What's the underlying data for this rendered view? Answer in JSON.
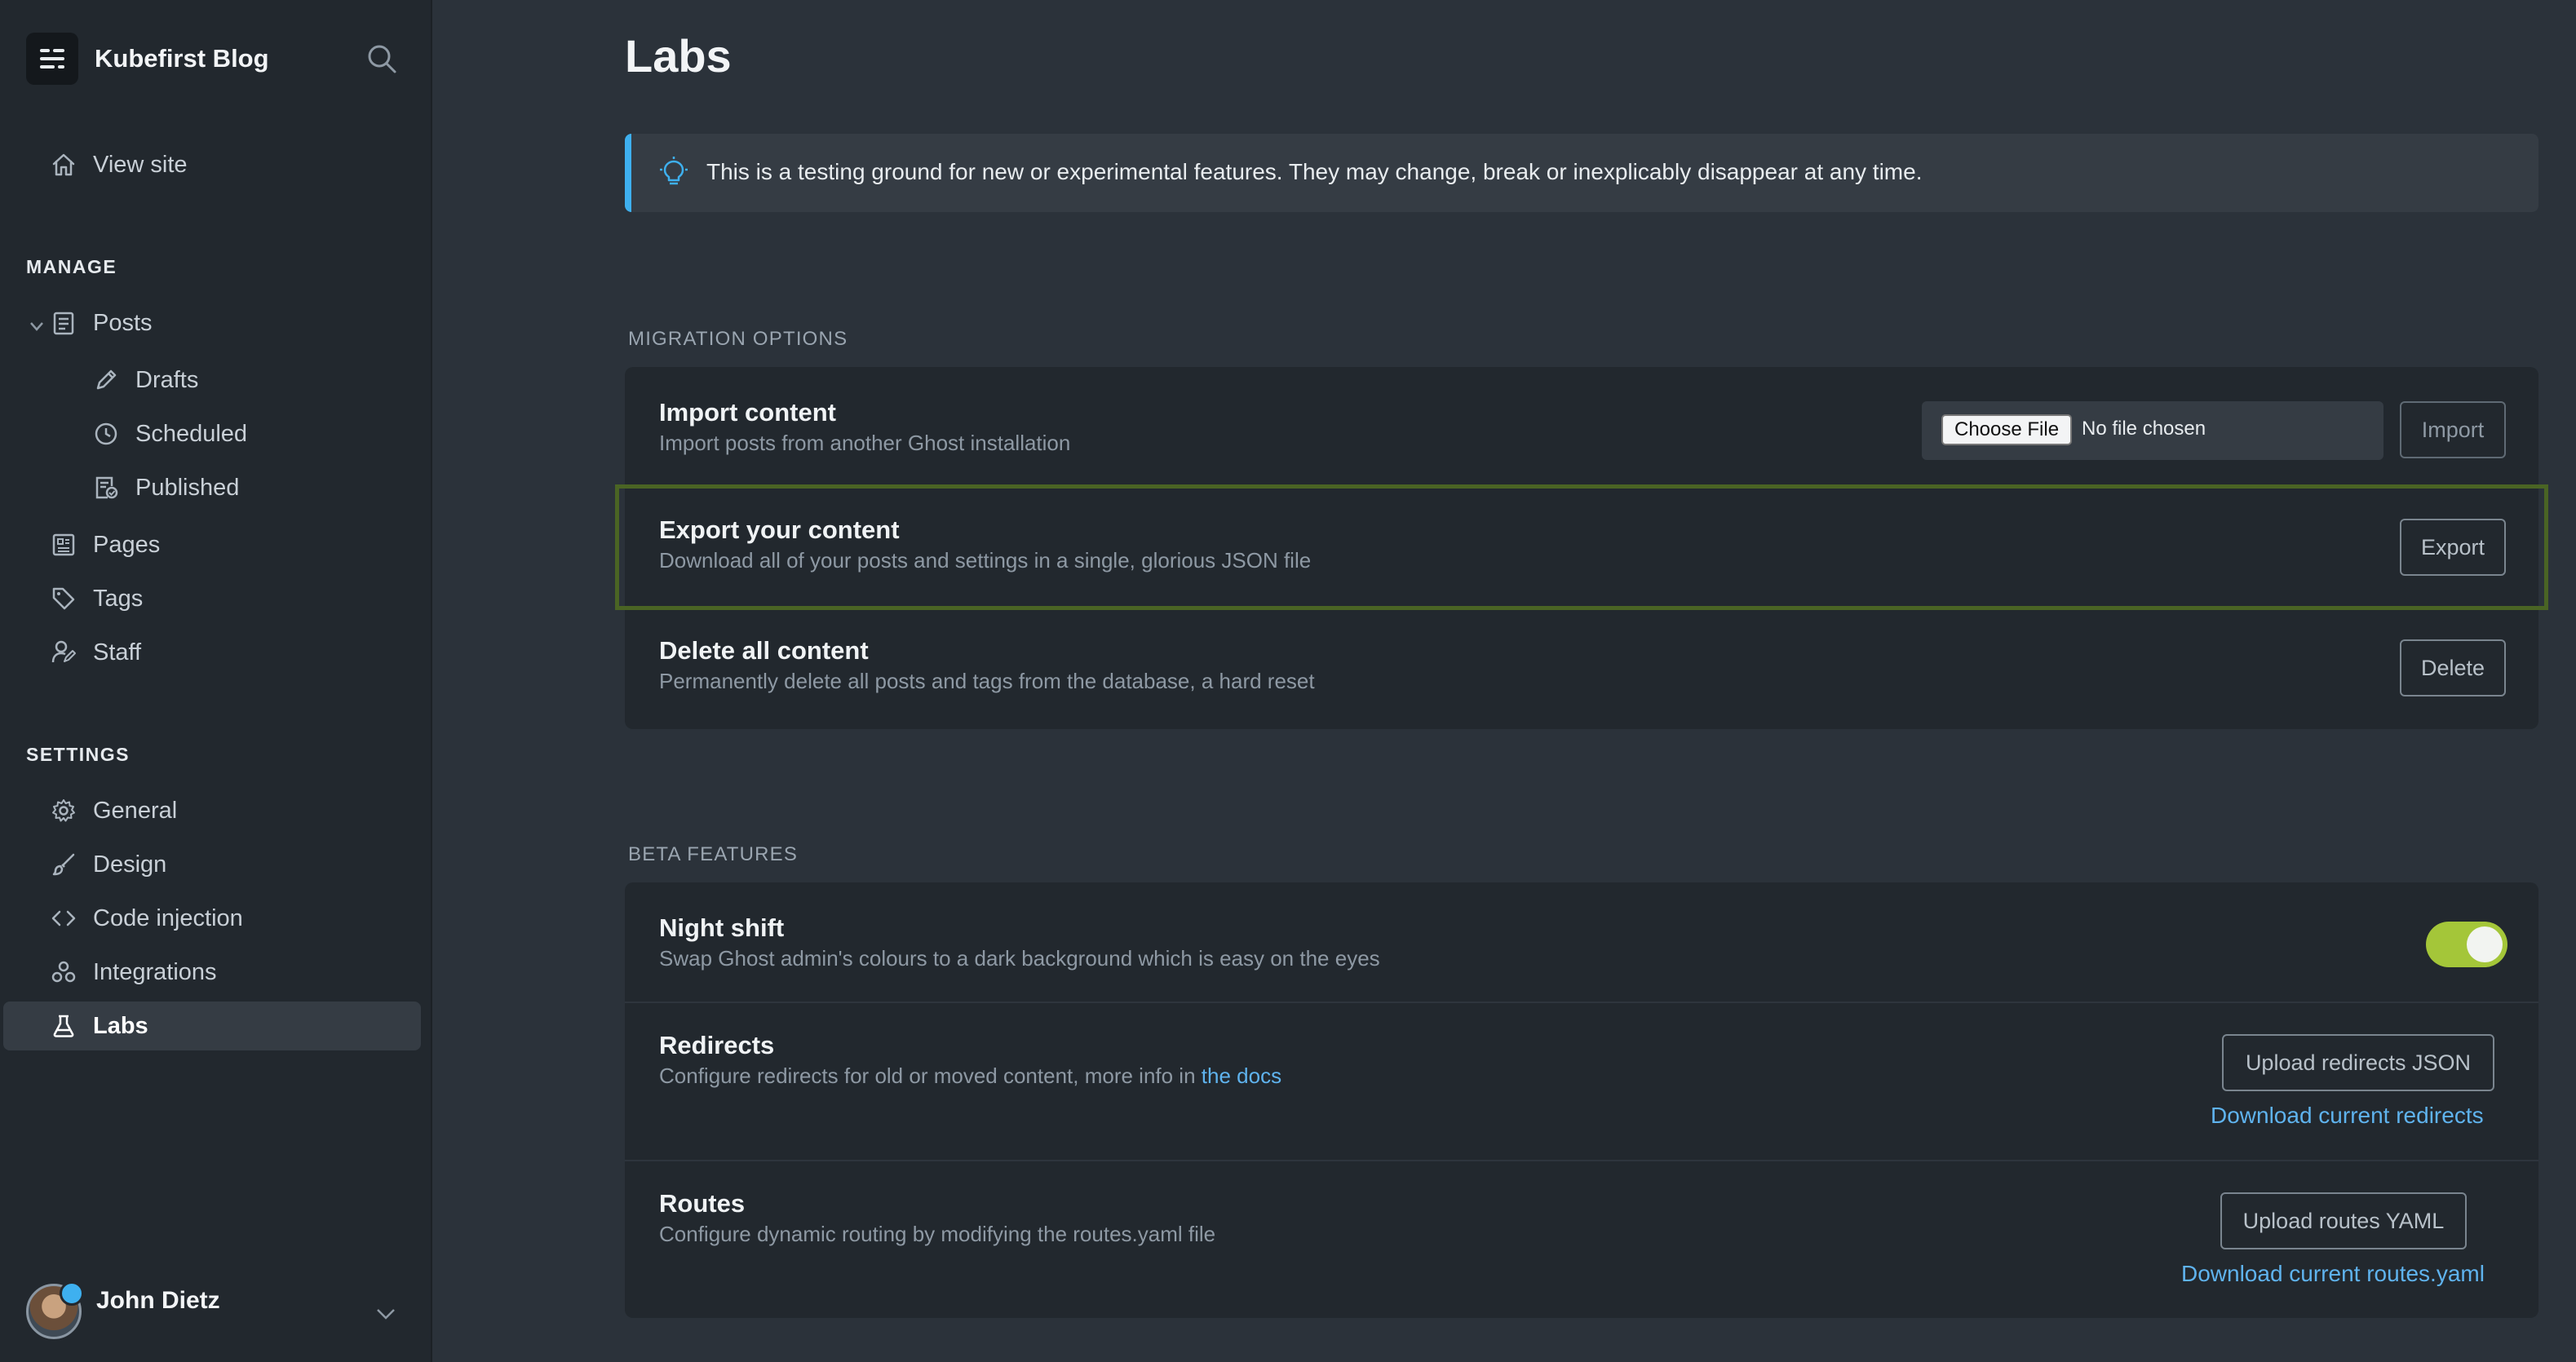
{
  "sidebar": {
    "brand": "Kubefirst Blog",
    "view_site": "View site",
    "manage_title": "MANAGE",
    "manage_items": {
      "posts": "Posts",
      "drafts": "Drafts",
      "scheduled": "Scheduled",
      "published": "Published",
      "pages": "Pages",
      "tags": "Tags",
      "staff": "Staff"
    },
    "settings_title": "SETTINGS",
    "settings_items": {
      "general": "General",
      "design": "Design",
      "code_injection": "Code injection",
      "integrations": "Integrations",
      "labs": "Labs"
    },
    "user_name": "John Dietz"
  },
  "main": {
    "title": "Labs",
    "alert": "This is a testing ground for new or experimental features. They may change, break or inexplicably disappear at any time.",
    "migration": {
      "title": "MIGRATION OPTIONS",
      "import": {
        "title": "Import content",
        "desc": "Import posts from another Ghost installation",
        "choose_file": "Choose File",
        "file_status": "No file chosen",
        "button": "Import"
      },
      "export": {
        "title": "Export your content",
        "desc": "Download all of your posts and settings in a single, glorious JSON file",
        "button": "Export"
      },
      "delete": {
        "title": "Delete all content",
        "desc": "Permanently delete all posts and tags from the database, a hard reset",
        "button": "Delete"
      }
    },
    "beta": {
      "title": "BETA FEATURES",
      "night_shift": {
        "title": "Night shift",
        "desc": "Swap Ghost admin's colours to a dark background which is easy on the eyes",
        "enabled": true
      },
      "redirects": {
        "title": "Redirects",
        "desc": "Configure redirects for old or moved content, more info in",
        "docs_link": "the docs",
        "upload_button": "Upload redirects JSON",
        "download_link": "Download current redirects"
      },
      "routes": {
        "title": "Routes",
        "desc": "Configure dynamic routing by modifying the routes.yaml file",
        "upload_button": "Upload routes YAML",
        "download_link": "Download current routes.yaml"
      }
    }
  },
  "colors": {
    "accent_blue": "#3eb0ef",
    "toggle_green": "#a4c639",
    "highlight_border": "#4a6424",
    "sidebar_bg": "#22282e",
    "main_bg": "#2b323a"
  }
}
